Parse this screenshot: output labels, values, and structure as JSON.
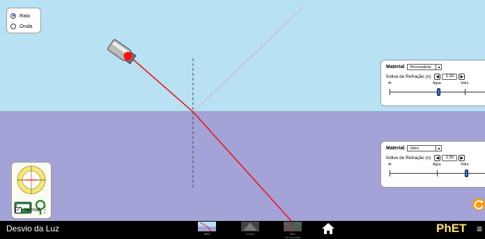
{
  "app": {
    "title": "Desvio da Luz",
    "brand": "PhET"
  },
  "view_mode": {
    "options": [
      {
        "label": "Raio",
        "selected": true
      },
      {
        "label": "Onda",
        "selected": false
      }
    ]
  },
  "top_material": {
    "material_label": "Material",
    "selected": "Personalizar",
    "index_label": "Índice de Refração (n)",
    "value": "1.33",
    "slider_labels": [
      "Ar",
      "Água",
      "Vidro"
    ],
    "slider_fraction": 0.5
  },
  "bottom_material": {
    "material_label": "Material",
    "selected": "Vidro",
    "index_label": "Índice de Refração (n)",
    "value": "1.50",
    "slider_labels": [
      "Ar",
      "Água",
      "Vidro"
    ],
    "slider_fraction": 0.79
  },
  "tools": {
    "normal_label": "Normal",
    "normal_checked": true
  },
  "nav": [
    {
      "label": "Intro",
      "active": true
    },
    {
      "label": "Prisms",
      "active": false
    },
    {
      "label": "Mais Ferramentas",
      "active": false
    }
  ],
  "colors": {
    "top_medium": "#b8e1f3",
    "bottom_medium": "#a3a3d8",
    "ray": "#ee1111",
    "reflected_ray": "#d2b4c6",
    "nav_active": "#f6d34a",
    "nav_inactive": "#888888"
  }
}
